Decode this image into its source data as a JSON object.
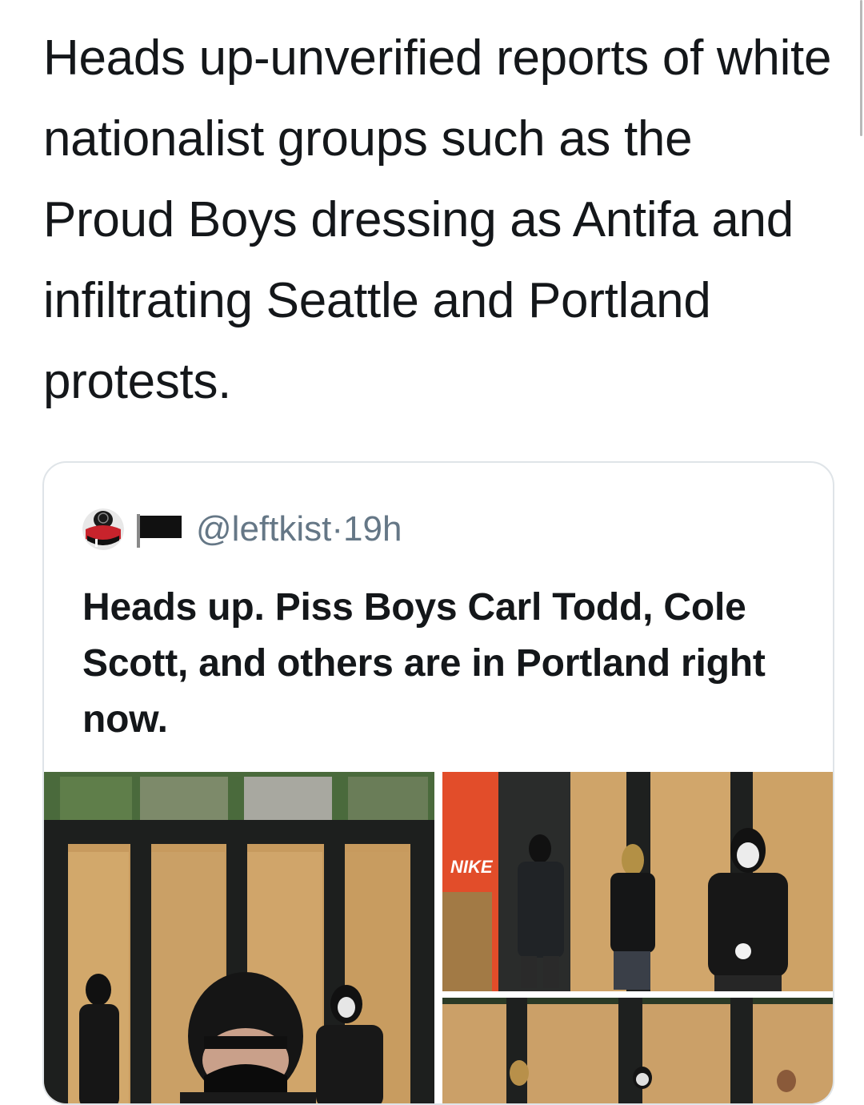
{
  "tweet": {
    "text": "Heads up-unverified reports of white nationalist groups such as the Proud Boys dressing as Antifa and infiltrating Seattle and Portland protests."
  },
  "quoted_tweet": {
    "handle": "@leftkist",
    "separator": "·",
    "time": "19h",
    "text": "Heads up. Piss Boys Carl Todd, Cole Scott, and others are in Portland right now.",
    "avatar_icon": "masked-figure-avatar",
    "flag_icon": "black-flag-icon",
    "media": [
      {
        "icon": "photo-selfie-masked-group"
      },
      {
        "icon": "photo-masked-group-nike-store",
        "sign_text": "NIKE"
      },
      {
        "icon": "photo-masked-group-boarded-windows"
      }
    ]
  },
  "colors": {
    "text_primary": "#14171a",
    "text_secondary": "#657786",
    "card_border": "#dfe4e8",
    "background": "#ffffff"
  }
}
